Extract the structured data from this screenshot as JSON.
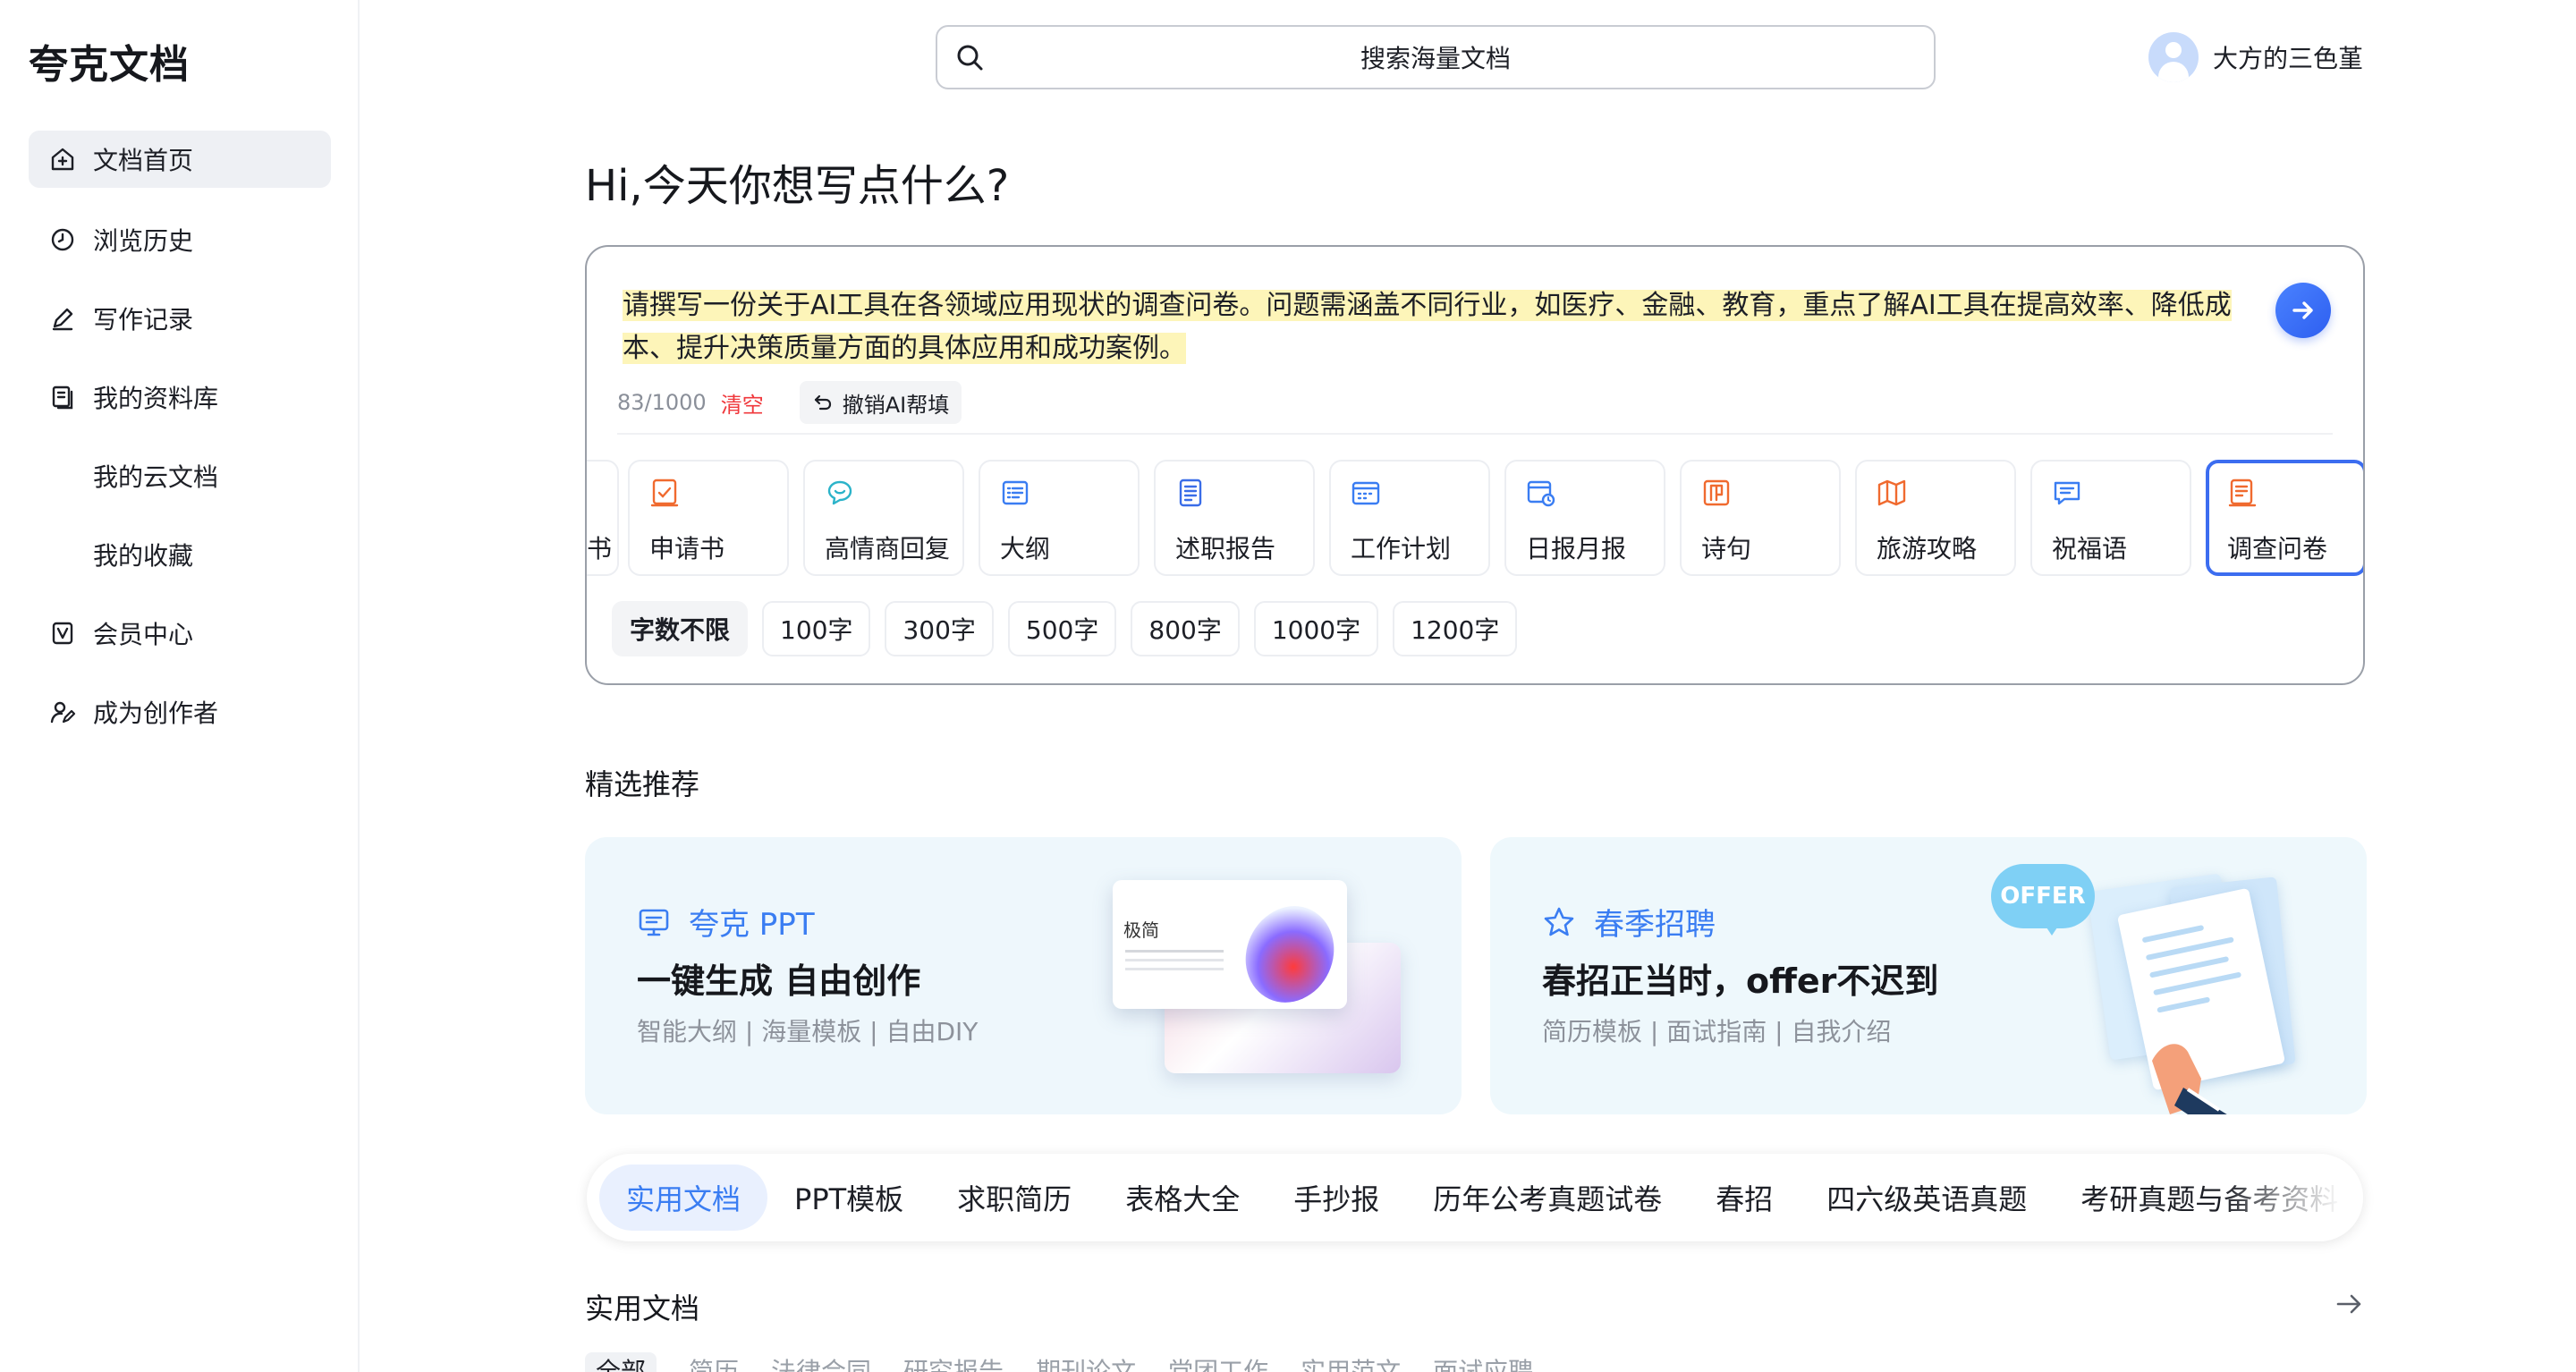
{
  "sidebar": {
    "logo": "夸克文档",
    "items": [
      {
        "label": "文档首页",
        "icon": "home-icon",
        "active": true
      },
      {
        "label": "浏览历史",
        "icon": "clock-icon"
      },
      {
        "label": "写作记录",
        "icon": "pen-icon"
      },
      {
        "label": "我的资料库",
        "icon": "library-icon"
      },
      {
        "label": "我的云文档"
      },
      {
        "label": "我的收藏"
      },
      {
        "label": "会员中心",
        "icon": "vip-icon"
      },
      {
        "label": "成为创作者",
        "icon": "creator-icon"
      }
    ]
  },
  "header": {
    "search_placeholder": "搜索海量文档",
    "user_name": "大方的三色堇"
  },
  "greeting": "Hi,今天你想写点什么?",
  "compose": {
    "prompt": "请撰写一份关于AI工具在各领域应用现状的调查问卷。问题需涵盖不同行业，如医疗、金融、教育，重点了解AI工具在提高效率、降低成本、提升决策质量方面的具体应用和成功案例。",
    "counter": "83/1000",
    "clear_label": "清空",
    "undo_label": "撤销AI帮填",
    "partial_type_label": "书",
    "types": [
      {
        "label": "申请书",
        "icon": "application-icon",
        "color": "#f06a2f"
      },
      {
        "label": "高情商回复",
        "icon": "chat-bubble-icon",
        "color": "#2bb3c9"
      },
      {
        "label": "大纲",
        "icon": "outline-icon",
        "color": "#3a7df2"
      },
      {
        "label": "述职报告",
        "icon": "report-icon",
        "color": "#3a6de8"
      },
      {
        "label": "工作计划",
        "icon": "plan-icon",
        "color": "#3a7df2"
      },
      {
        "label": "日报月报",
        "icon": "calendar-report-icon",
        "color": "#3a7df2"
      },
      {
        "label": "诗句",
        "icon": "poem-icon",
        "color": "#f06a2f"
      },
      {
        "label": "旅游攻略",
        "icon": "map-icon",
        "color": "#f06a2f"
      },
      {
        "label": "祝福语",
        "icon": "message-icon",
        "color": "#3a7df2"
      },
      {
        "label": "调查问卷",
        "icon": "survey-icon",
        "color": "#f06a2f",
        "selected": true
      }
    ],
    "lengths": [
      "字数不限",
      "100字",
      "300字",
      "500字",
      "800字",
      "1000字",
      "1200字"
    ],
    "active_length": "字数不限"
  },
  "featured": {
    "title": "精选推荐",
    "cards": [
      {
        "brand": "夸克 PPT",
        "headline": "一键生成 自由创作",
        "sub": "智能大纲 | 海量模板 | 自由DIY",
        "art_title": "极简"
      },
      {
        "brand": "春季招聘",
        "headline": "春招正当时，offer不迟到",
        "sub": "简历模板 | 面试指南 | 自我介绍",
        "badge": "OFFER"
      }
    ]
  },
  "categories": [
    "实用文档",
    "PPT模板",
    "求职简历",
    "表格大全",
    "手抄报",
    "历年公考真题试卷",
    "春招",
    "四六级英语真题",
    "考研真题与备考资料"
  ],
  "active_category": "实用文档",
  "practical": {
    "title": "实用文档",
    "sub_tabs": [
      "全部",
      "简历",
      "法律合同",
      "研究报告",
      "期刊论文",
      "党团工作",
      "实用范文",
      "面试应聘"
    ]
  },
  "colors": {
    "accent": "#3a7df2",
    "danger": "#f0383c",
    "highlight": "#fdf5b9",
    "selected_border": "#3c6df0"
  }
}
